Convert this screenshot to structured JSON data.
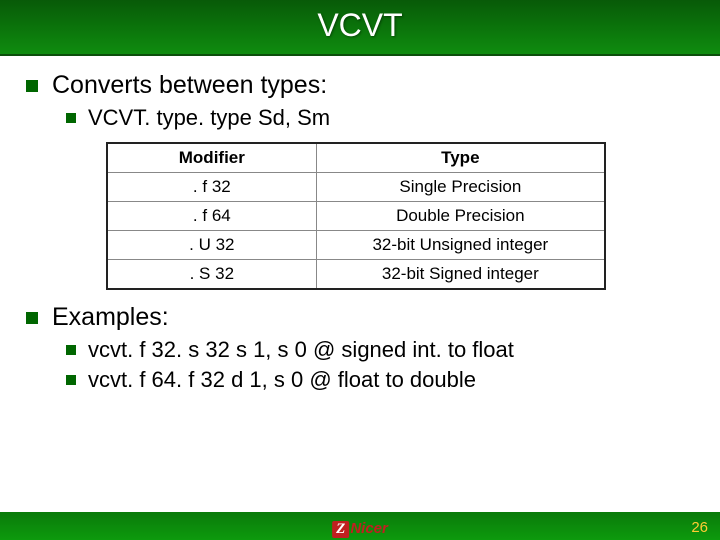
{
  "title": "VCVT",
  "section1": {
    "heading": "Converts between types:",
    "sub": "VCVT. type. type    Sd, Sm"
  },
  "table": {
    "headers": [
      "Modifier",
      "Type"
    ],
    "rows": [
      [
        ". f 32",
        "Single Precision"
      ],
      [
        ". f 64",
        "Double Precision"
      ],
      [
        ". U 32",
        "32-bit Unsigned integer"
      ],
      [
        ". S 32",
        "32-bit Signed integer"
      ]
    ]
  },
  "section2": {
    "heading": "Examples:",
    "items": [
      {
        "code": "vcvt. f 32. s 32 s 1, s 0",
        "comment": "@ signed int. to float"
      },
      {
        "code": "vcvt. f 64. f 32 d 1, s 0",
        "comment": "@ float to double"
      }
    ]
  },
  "footer": {
    "logo_z": "Z",
    "logo_rest": "Nicer",
    "page": "26"
  }
}
